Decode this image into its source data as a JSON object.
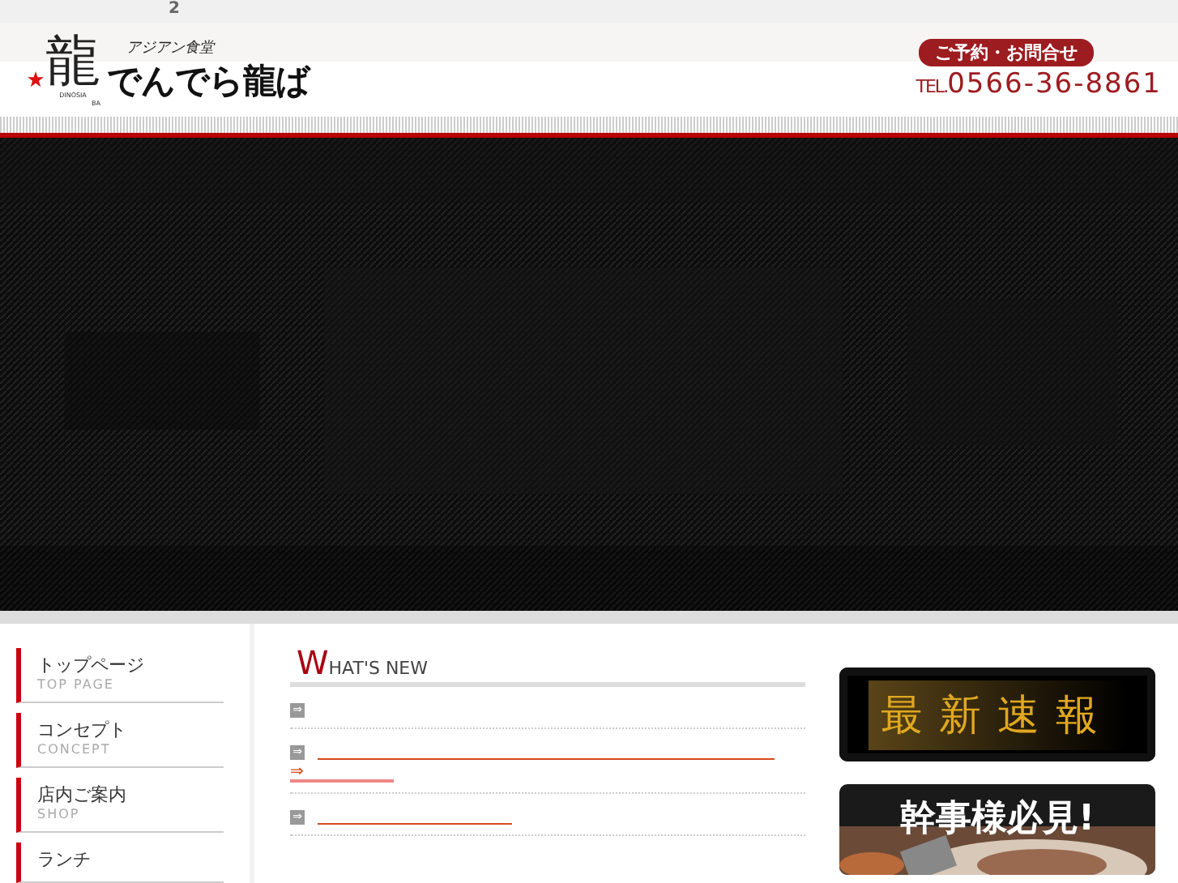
{
  "top_strip": {
    "text": "2"
  },
  "logo": {
    "kanji": "龍",
    "tagline": "アジアン食堂",
    "name": "でんでら龍ば",
    "roman": "DINOSIA",
    "small": "BA"
  },
  "contact": {
    "badge": "ご予約・お問合せ",
    "tel_prefix": "TEL.",
    "tel": "0566-36-8861"
  },
  "nav": [
    {
      "label": "トップページ",
      "sub": "TOP PAGE"
    },
    {
      "label": "コンセプト",
      "sub": "CONCEPT"
    },
    {
      "label": "店内ご案内",
      "sub": "SHOP"
    },
    {
      "label": "ランチ"
    }
  ],
  "news": {
    "title_initial": "W",
    "title_rest": "HAT'S NEW",
    "items": [
      {
        "kind": "plain",
        "arrow": "⇒"
      },
      {
        "kind": "link_more",
        "arrow": "⇒",
        "more": "⇒"
      },
      {
        "kind": "link",
        "arrow": "⇒"
      }
    ]
  },
  "banners": [
    {
      "kind": "news",
      "text": "最新速報"
    },
    {
      "text": "幹事様必見!"
    }
  ]
}
